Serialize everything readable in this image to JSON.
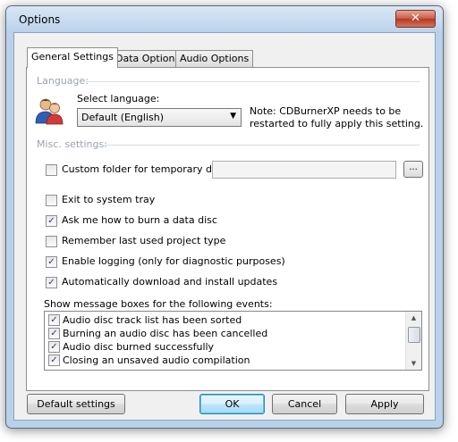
{
  "window": {
    "title": "Options",
    "close_glyph": "✕"
  },
  "tabs": [
    {
      "label": "General Settings",
      "active": true
    },
    {
      "label": "Data Options",
      "active": false
    },
    {
      "label": "Audio Options",
      "active": false
    }
  ],
  "language": {
    "group_label": "Language:",
    "select_label": "Select language:",
    "selected": "Default (English)",
    "note_line1": "Note: CDBurnerXP needs to be",
    "note_line2": "restarted to fully apply this setting.",
    "icon": "users-icon"
  },
  "misc": {
    "group_label": "Misc. settings:",
    "temp_folder_label": "Custom folder for temporary data:",
    "temp_folder_value": "",
    "browse_label": "...",
    "options": [
      {
        "label": "Custom folder for temporary data:",
        "checked": false
      },
      {
        "label": "Exit to system tray",
        "checked": false
      },
      {
        "label": "Ask me how to burn a data disc",
        "checked": true
      },
      {
        "label": "Remember last used project type",
        "checked": false
      },
      {
        "label": "Enable logging (only for diagnostic purposes)",
        "checked": true
      },
      {
        "label": "Automatically download and install updates",
        "checked": true
      }
    ]
  },
  "messages": {
    "label": "Show message boxes for the following events:",
    "items": [
      {
        "label": "Audio disc track list has been sorted",
        "checked": true
      },
      {
        "label": "Burning an audio disc has been cancelled",
        "checked": true
      },
      {
        "label": "Audio disc burned successfully",
        "checked": true
      },
      {
        "label": "Closing an unsaved audio compilation",
        "checked": true
      }
    ]
  },
  "buttons": {
    "default_settings": "Default settings",
    "ok": "OK",
    "cancel": "Cancel",
    "apply": "Apply"
  },
  "check_glyph": "✓",
  "colors": {
    "accent": "#3c7fb1",
    "group_label": "#9aa3ad",
    "close": "#c75b45"
  }
}
